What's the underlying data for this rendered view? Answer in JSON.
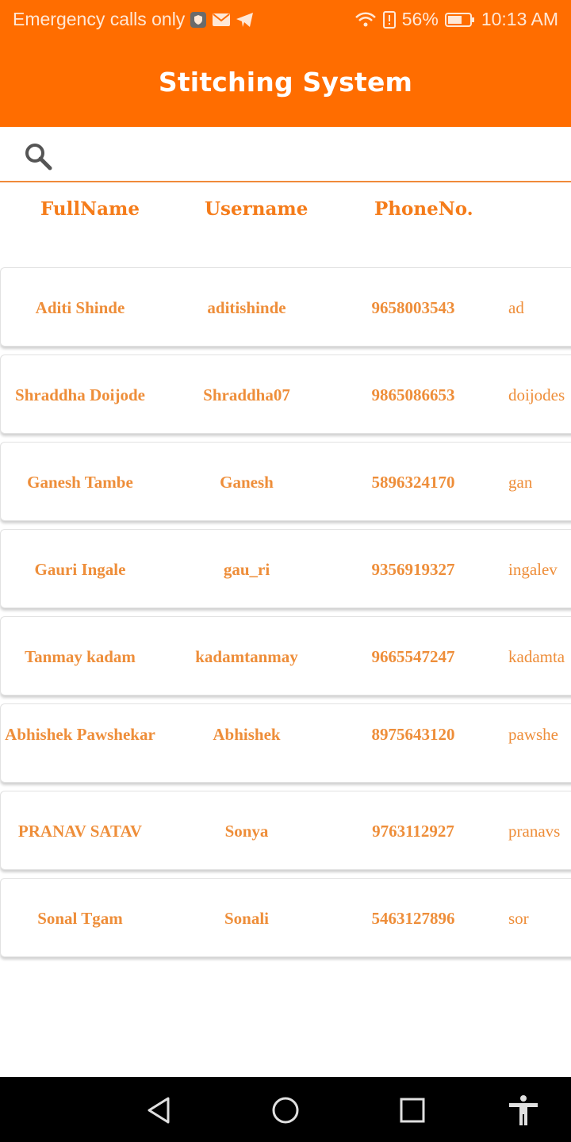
{
  "status_bar": {
    "carrier": "Emergency calls only",
    "battery": "56%",
    "time": "10:13 AM"
  },
  "app": {
    "title": "Stitching System"
  },
  "search": {
    "placeholder": ""
  },
  "table": {
    "headers": [
      "FullName",
      "Username",
      "PhoneNo."
    ],
    "rows": [
      {
        "full_name": "Aditi Shinde",
        "username": "aditishinde",
        "phone": "9658003543",
        "email": "ad"
      },
      {
        "full_name": "Shraddha Doijode",
        "username": "Shraddha07",
        "phone": "9865086653",
        "email": "doijodes"
      },
      {
        "full_name": "Ganesh Tambe",
        "username": "Ganesh",
        "phone": "5896324170",
        "email": "gan"
      },
      {
        "full_name": "Gauri Ingale",
        "username": "gau_ri",
        "phone": "9356919327",
        "email": "ingalev"
      },
      {
        "full_name": "Tanmay kadam",
        "username": "kadamtanmay",
        "phone": "9665547247",
        "email": "kadamta"
      },
      {
        "full_name": "Abhishek Pawshekar",
        "username": "Abhishek",
        "phone": "8975643120",
        "email": "pawshe"
      },
      {
        "full_name": "PRANAV SATAV",
        "username": "Sonya",
        "phone": "9763112927",
        "email": "pranavs"
      },
      {
        "full_name": "Sonal Tgam",
        "username": "Sonali",
        "phone": "5463127896",
        "email": "sor"
      }
    ]
  },
  "colors": {
    "primary": "#FF6D00",
    "text_accent": "#EE8E3A"
  },
  "nav": {
    "icons": [
      "back-icon",
      "home-icon",
      "recents-icon",
      "accessibility-icon"
    ]
  }
}
